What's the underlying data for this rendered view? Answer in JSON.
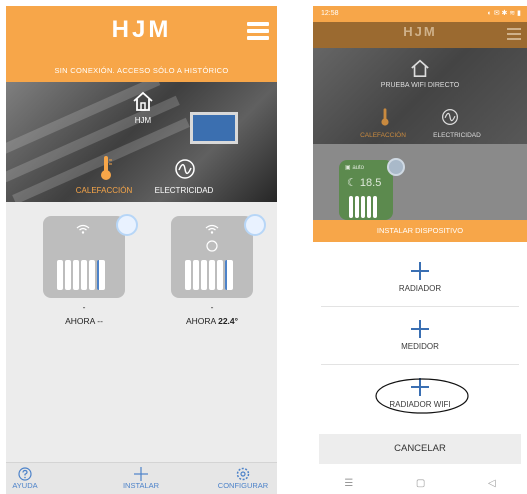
{
  "left_screen": {
    "logo": "HJM",
    "notice": "SIN CONEXIÓN. ACCESO SÓLO A HISTÓRICO",
    "home_label": "HJM",
    "tabs": [
      "CALEFACCIÓN",
      "ELECTRICIDAD"
    ],
    "devices": [
      {
        "dash": "-",
        "prefix": "AHORA",
        "value": "--"
      },
      {
        "dash": "-",
        "prefix": "AHORA",
        "value": "22.4°"
      }
    ],
    "bottom_nav": [
      "AYUDA",
      "INSTALAR",
      "CONFIGURAR"
    ]
  },
  "right_screen": {
    "status_time": "12:58",
    "logo": "HJM",
    "home_label": "PRUEBA WIFI DIRECTO",
    "tabs": [
      "CALEFACCIÓN",
      "ELECTRICIDAD"
    ],
    "device_mode": "auto",
    "device_temp": "18.5",
    "install_header": "INSTALAR DISPOSITIVO",
    "actions": [
      "RADIADOR",
      "MEDIDOR",
      "RADIADOR WIFI"
    ],
    "cancel_label": "CANCELAR",
    "sys_nav": [
      "☰",
      "▢",
      "◁"
    ]
  },
  "colors": {
    "accent": "#f7a649",
    "link_blue": "#4c82c9"
  }
}
